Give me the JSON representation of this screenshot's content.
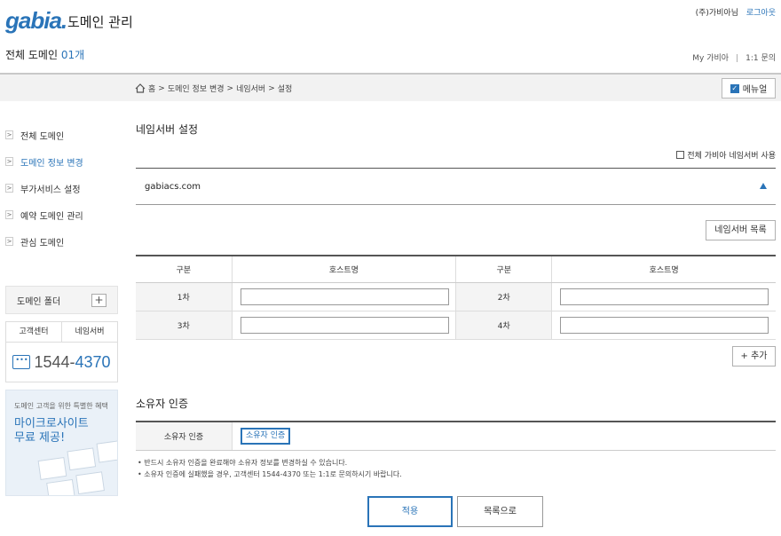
{
  "header": {
    "logo_text": "gabia.",
    "app_title": "도메인 관리",
    "user_name": "(주)가비아님",
    "logout": "로그아웃",
    "all_domains_label": "전체 도메인",
    "domain_count": "01개",
    "links": [
      "My 가비아",
      "1:1 문의"
    ]
  },
  "breadcrumb": {
    "items": [
      "홈",
      "도메인 정보 변경",
      "네임서버",
      "설정"
    ],
    "separator": ">",
    "manual_button": "메뉴얼"
  },
  "sidebar": {
    "items": [
      {
        "label": "전체 도메인",
        "active": false
      },
      {
        "label": "도메인 정보 변경",
        "active": true
      },
      {
        "label": "부가서비스 설정",
        "active": false
      },
      {
        "label": "예약 도메인 관리",
        "active": false
      },
      {
        "label": "관심 도메인",
        "active": false
      }
    ],
    "arrow_glyph": ">",
    "folder_label": "도메인 폴더",
    "folder_add": "+",
    "support_tabs": [
      "고객센터",
      "네임서버"
    ],
    "phone_prefix": "1544-",
    "phone_suffix": "4370",
    "promo_subtitle": "도메인 고객을 위한 특별한 혜택",
    "promo_title_1": "마이크로사이트",
    "promo_title_2": "무료 제공!"
  },
  "nameserver": {
    "title": "네임서버 설정",
    "use_all_label": "전체 가비아 네임서버 사용",
    "domain": "gabiacs.com",
    "list_button": "네임서버 목록",
    "col_type": "구분",
    "col_host": "호스트명",
    "rows": [
      {
        "left": "1차",
        "right": "2차"
      },
      {
        "left": "3차",
        "right": "4차"
      }
    ],
    "add_button": "+ 추가"
  },
  "owner": {
    "title": "소유자 인증",
    "label": "소유자 인증",
    "button": "소유자 인증",
    "notes": [
      "반드시 소유자 인증을 완료해야 소유자 정보를 변경하실 수 있습니다.",
      "소유자 인증에 실패했을 경우, 고객센터 1544-4370 또는 1:1로 문의하시기 바랍니다."
    ]
  },
  "footer": {
    "apply": "적용",
    "back_to_list": "목록으로"
  },
  "colors": {
    "accent": "#2a74b8"
  }
}
